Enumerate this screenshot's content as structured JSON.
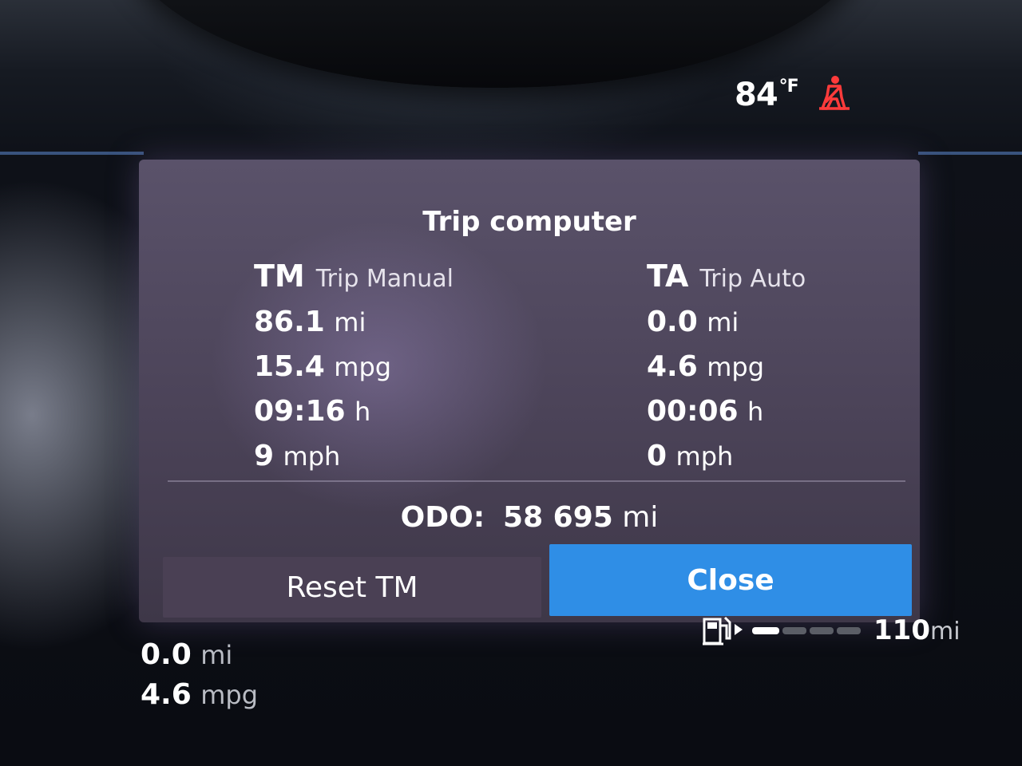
{
  "status": {
    "temperature_value": "84",
    "temperature_unit": "°F",
    "warning_icon": "seatbelt-warning-icon",
    "warning_color": "#ff3b3b"
  },
  "trip_computer": {
    "title": "Trip computer",
    "trip_manual": {
      "abbr": "TM",
      "label": "Trip Manual",
      "distance": {
        "value": "86.1",
        "unit": "mi"
      },
      "economy": {
        "value": "15.4",
        "unit": "mpg"
      },
      "time": {
        "value": "09:16",
        "unit": "h"
      },
      "speed": {
        "value": "9",
        "unit": "mph"
      }
    },
    "trip_auto": {
      "abbr": "TA",
      "label": "Trip Auto",
      "distance": {
        "value": "0.0",
        "unit": "mi"
      },
      "economy": {
        "value": "4.6",
        "unit": "mpg"
      },
      "time": {
        "value": "00:06",
        "unit": "h"
      },
      "speed": {
        "value": "0",
        "unit": "mph"
      }
    },
    "odometer": {
      "label": "ODO:",
      "value": "58 695",
      "unit": "mi"
    },
    "buttons": {
      "reset": "Reset TM",
      "close": "Close"
    },
    "accent_color": "#2f8ee6"
  },
  "fuel": {
    "icon": "fuel-pump-icon",
    "level_fraction": 0.2,
    "range_value": "110",
    "range_unit": "mi"
  },
  "bottom_left": {
    "distance": {
      "value": "0.0",
      "unit": "mi"
    },
    "economy": {
      "value": "4.6",
      "unit": "mpg"
    }
  }
}
